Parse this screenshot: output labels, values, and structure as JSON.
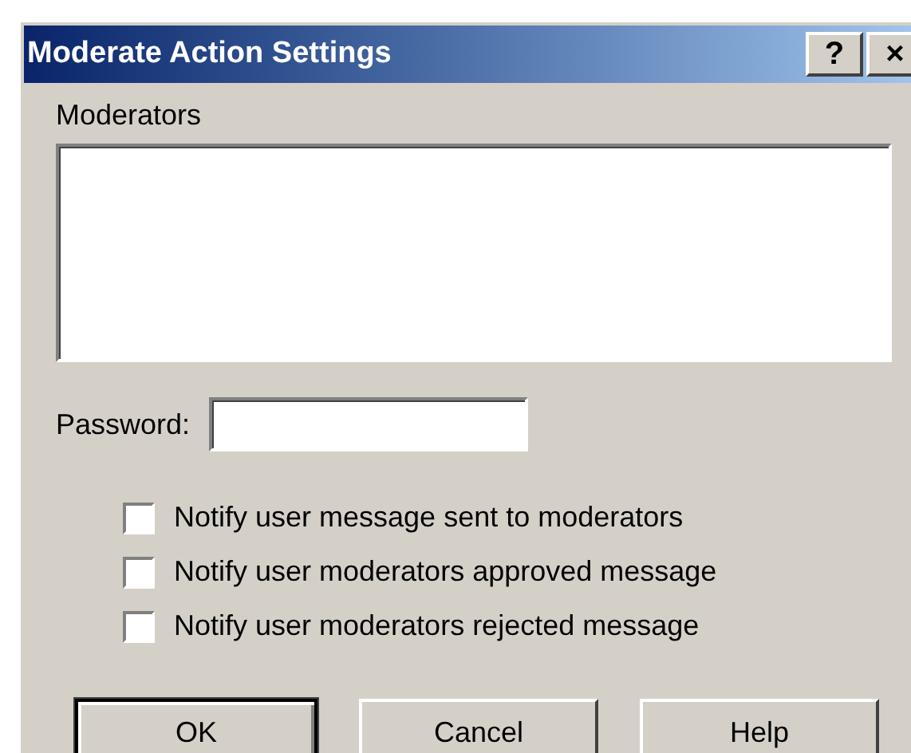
{
  "window": {
    "title": "Moderate Action Settings",
    "title_buttons": [
      "?",
      "×"
    ]
  },
  "moderators": {
    "label": "Moderators"
  },
  "password": {
    "label": "Password:"
  },
  "options": [
    {
      "label": "Notify user message sent to moderators",
      "checked": false
    },
    {
      "label": "Notify user moderators approved message",
      "checked": false
    },
    {
      "label": "Notify user moderators rejected message",
      "checked": false
    }
  ],
  "buttons": [
    {
      "label": "OK",
      "default": true
    },
    {
      "label": "Cancel",
      "default": false
    },
    {
      "label": "Help",
      "default": false
    }
  ]
}
